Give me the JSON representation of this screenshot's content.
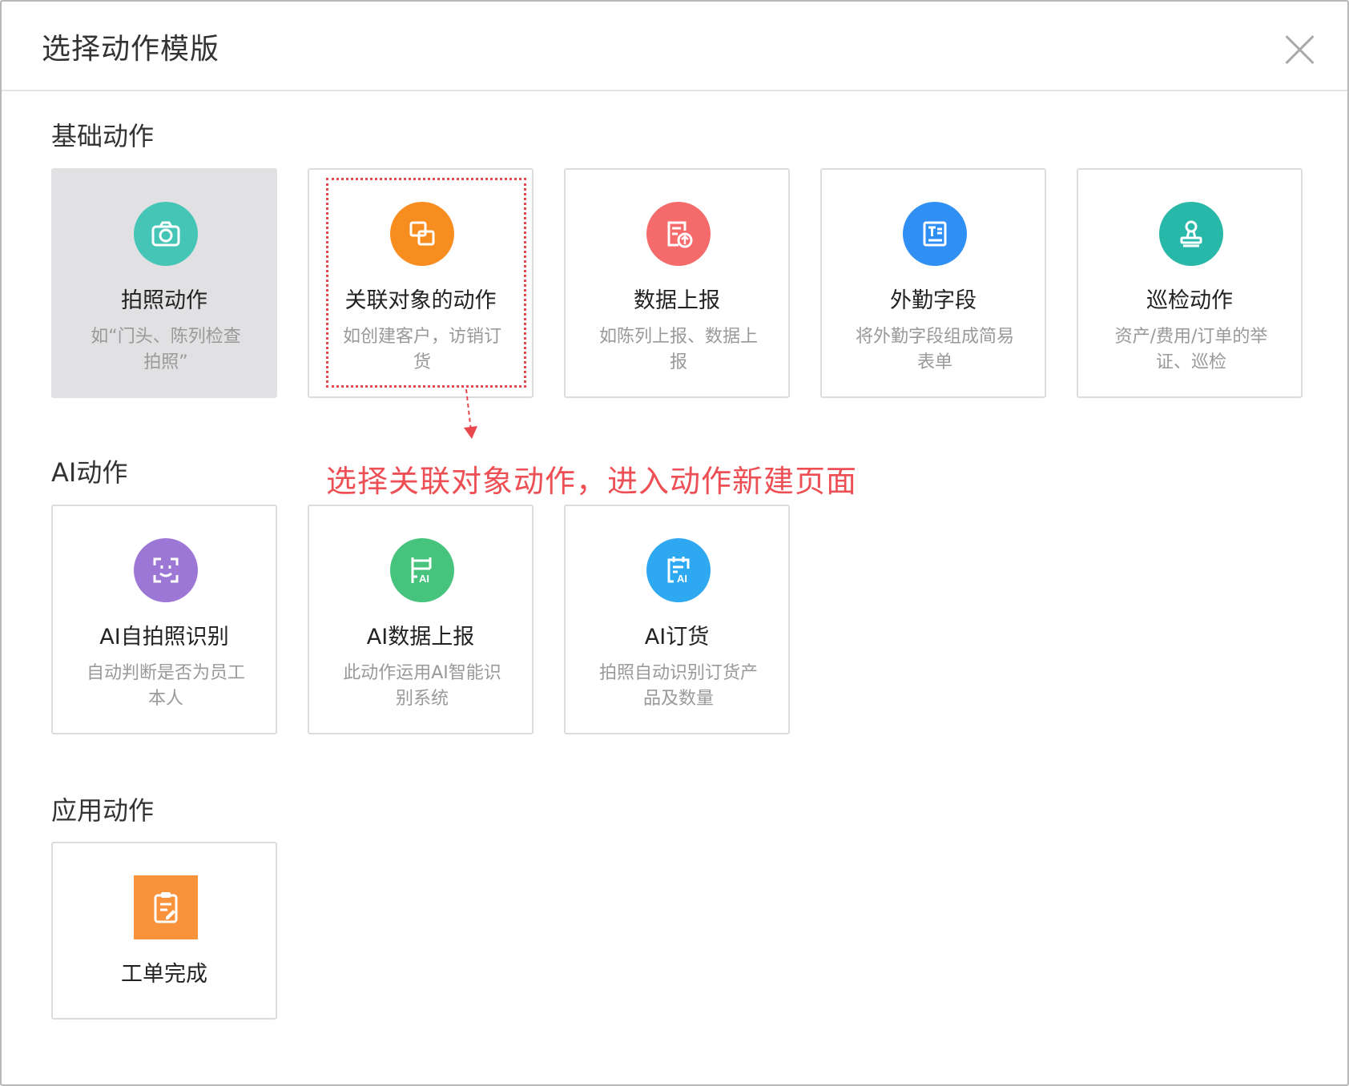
{
  "dialog": {
    "title": "选择动作模版"
  },
  "sections": [
    {
      "title": "基础动作",
      "cards": [
        {
          "name": "拍照动作",
          "desc": "如“门头、陈列检查拍照”",
          "icon": "camera-icon",
          "color": "#45c5b6"
        },
        {
          "name": "关联对象的动作",
          "desc": "如创建客户，访销订货",
          "icon": "linked-objects-icon",
          "color": "#f78d1f"
        },
        {
          "name": "数据上报",
          "desc": "如陈列上报、数据上报",
          "icon": "data-upload-icon",
          "color": "#f56b6b"
        },
        {
          "name": "外勤字段",
          "desc": "将外勤字段组成简易表单",
          "icon": "form-field-icon",
          "color": "#2f8ff2"
        },
        {
          "name": "巡检动作",
          "desc": "资产/费用/订单的举证、巡检",
          "icon": "stamp-icon",
          "color": "#28b8a9"
        }
      ]
    },
    {
      "title": "AI动作",
      "cards": [
        {
          "name": "AI自拍照识别",
          "desc": "自动判断是否为员工本人",
          "icon": "face-scan-icon",
          "color": "#9c77d6"
        },
        {
          "name": "AI数据上报",
          "desc": "此动作运用AI智能识别系统",
          "icon": "ai-shelf-icon",
          "color": "#46c37d"
        },
        {
          "name": "AI订货",
          "desc": "拍照自动识别订货产品及数量",
          "icon": "ai-order-icon",
          "color": "#2ea8f1"
        }
      ]
    },
    {
      "title": "应用动作",
      "cards": [
        {
          "name": "工单完成",
          "desc": "",
          "icon": "clipboard-icon",
          "color": "#f8923b"
        }
      ]
    }
  ],
  "annotation": {
    "text": "选择关联对象动作，进入动作新建页面",
    "color": "#ed4f55"
  }
}
